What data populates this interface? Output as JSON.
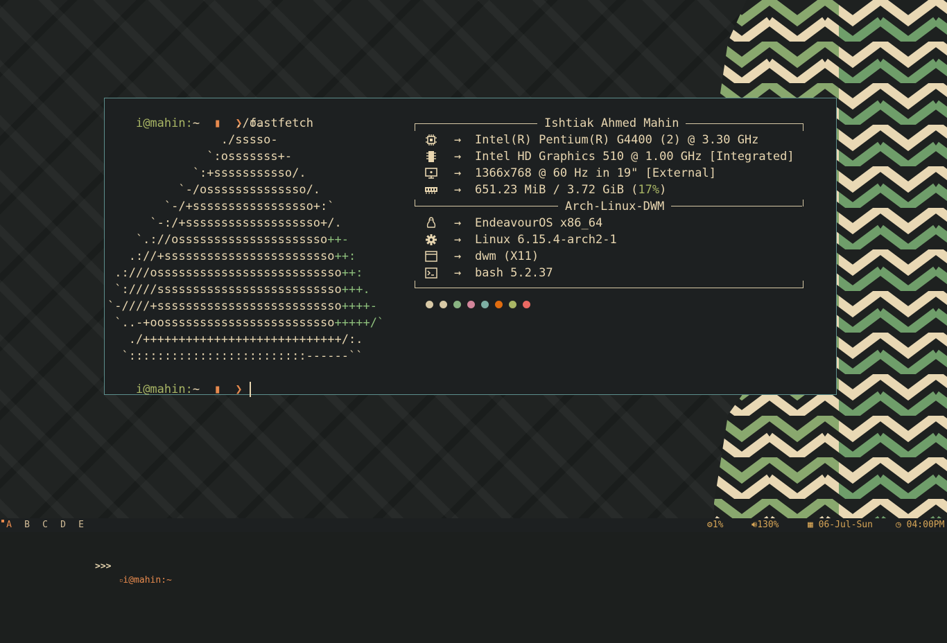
{
  "prompt": {
    "user": "i@mahin:",
    "dir": "~",
    "command": "fastfetch"
  },
  "logo": [
    {
      "pre": "                  ./o.",
      "acc": ""
    },
    {
      "pre": "                ./sssso-",
      "acc": ""
    },
    {
      "pre": "              `:osssssss+-",
      "acc": ""
    },
    {
      "pre": "            `:+sssssssssso/.",
      "acc": ""
    },
    {
      "pre": "          `-/ossssssssssssso/.",
      "acc": ""
    },
    {
      "pre": "        `-/+sssssssssssssssso+:`",
      "acc": ""
    },
    {
      "pre": "      `-:/+sssssssssssssssssso+/.",
      "acc": ""
    },
    {
      "pre": "    `.://osssssssssssssssssssso",
      "acc": "++-"
    },
    {
      "pre": "   .://+ssssssssssssssssssssssso",
      "acc": "++:"
    },
    {
      "pre": " .:///ossssssssssssssssssssssssso",
      "acc": "++:"
    },
    {
      "pre": " `:////ssssssssssssssssssssssssso",
      "acc": "+++."
    },
    {
      "pre": "`-////+ssssssssssssssssssssssssso",
      "acc": "++++-"
    },
    {
      "pre": " `..-+oossssssssssssssssssssssso",
      "acc": "+++++/`"
    },
    {
      "pre": "   ./++++++++++++++++++++++++++++/:.",
      "acc": ""
    },
    {
      "pre": "  `:::::::::::::::::::::::::------``",
      "acc": ""
    }
  ],
  "info": {
    "header_title": "Ishtiak Ahmed Mahin",
    "section_title": "Arch-Linux-DWM",
    "arrow": "→",
    "hardware": [
      {
        "icon": "cpu-icon",
        "value": "Intel(R) Pentium(R) G4400 (2) @ 3.30 GHz"
      },
      {
        "icon": "gpu-icon",
        "value": "Intel HD Graphics 510 @ 1.00 GHz [Integrated]"
      },
      {
        "icon": "display-icon",
        "value": "1366x768 @ 60 Hz in 19\" [External]"
      },
      {
        "icon": "memory-icon",
        "value_pre": "651.23 MiB / 3.72 GiB (",
        "value_pct": "17%",
        "value_post": ")"
      }
    ],
    "software": [
      {
        "icon": "linux-icon",
        "value": "EndeavourOS x86_64"
      },
      {
        "icon": "gear-icon",
        "value": "Linux 6.15.4-arch2-1"
      },
      {
        "icon": "window-icon",
        "value": "dwm (X11)"
      },
      {
        "icon": "terminal-icon",
        "value": "bash 5.2.37"
      }
    ],
    "palette": [
      "#d8c9a6",
      "#d8c9a6",
      "#89b482",
      "#d3869b",
      "#7daea3",
      "#e06c0f",
      "#a9b665",
      "#ea6962"
    ]
  },
  "bar": {
    "tags": [
      "A",
      "B",
      "C",
      "D",
      "E"
    ],
    "active_tag": "A",
    "layout": ">>>",
    "window_title": "i@mahin:~",
    "cpu": "1%",
    "volume": "130%",
    "date": "06-Jul-Sun",
    "time": "04:00PM"
  },
  "colors": {
    "accent": "#e78a4e",
    "green": "#a9b665",
    "fg": "#e8d6b0",
    "border": "#5d8f8d"
  }
}
